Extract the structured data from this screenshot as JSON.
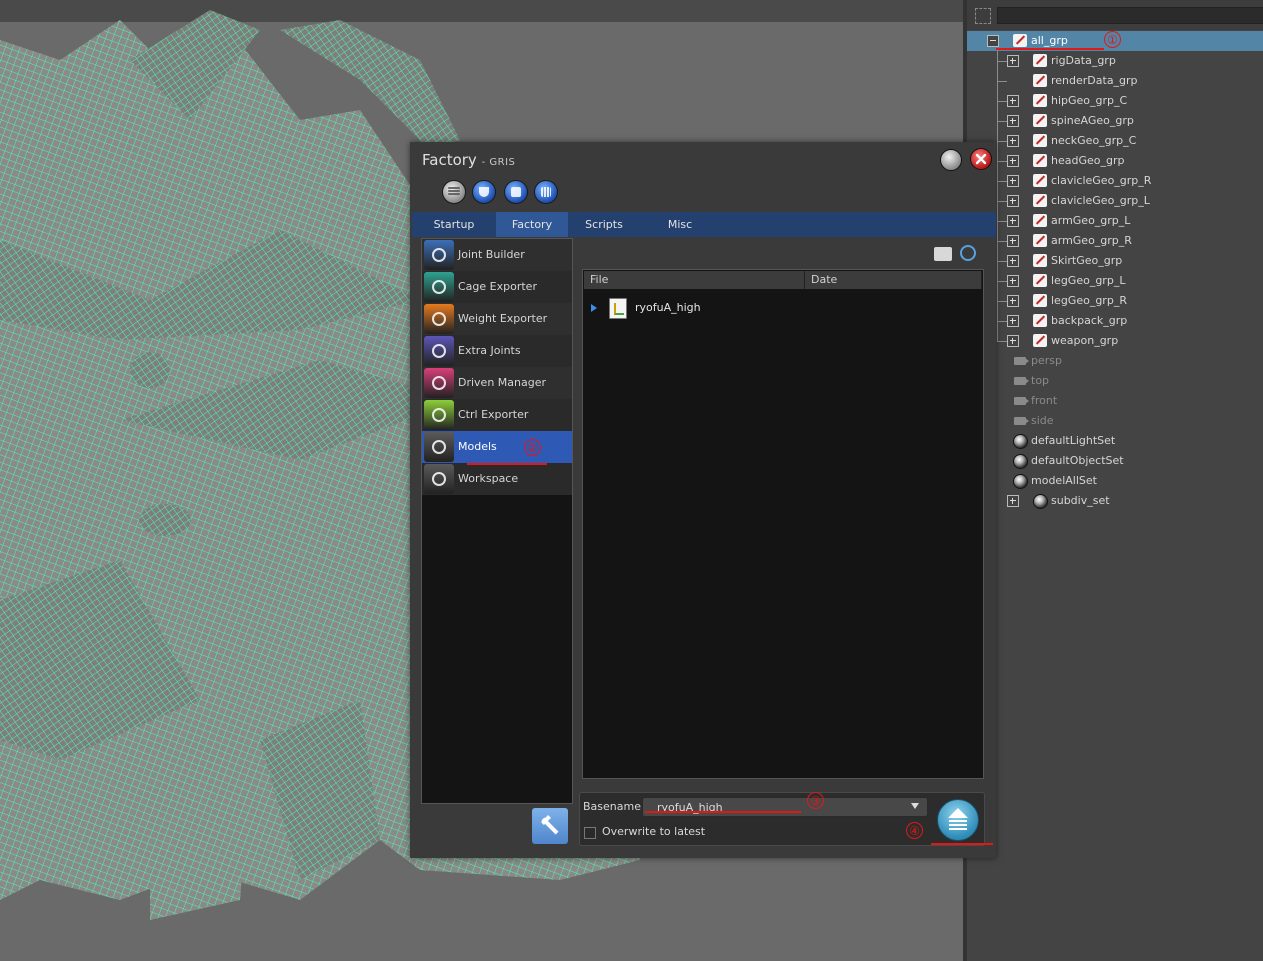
{
  "factory": {
    "title": "Factory",
    "subtitle": "GRIS",
    "tabs": [
      "Startup",
      "Factory",
      "Scripts",
      "Misc"
    ],
    "active_tab": "Factory",
    "tools": [
      {
        "label": "Joint Builder",
        "icon": "joint-builder-icon",
        "color": "#3c6fb8"
      },
      {
        "label": "Cage Exporter",
        "icon": "cage-exporter-icon",
        "color": "#2fa28f"
      },
      {
        "label": "Weight Exporter",
        "icon": "weight-exporter-icon",
        "color": "#e67a1e"
      },
      {
        "label": "Extra Joints",
        "icon": "extra-joints-icon",
        "color": "#5d56b8"
      },
      {
        "label": "Driven Manager",
        "icon": "driven-manager-icon",
        "color": "#d8407a"
      },
      {
        "label": "Ctrl Exporter",
        "icon": "ctrl-exporter-icon",
        "color": "#8ccf3a"
      },
      {
        "label": "Models",
        "icon": "models-icon",
        "color": "#5a5a5a"
      },
      {
        "label": "Workspace",
        "icon": "workspace-icon",
        "color": "#5a5a5a"
      }
    ],
    "selected_tool": "Models",
    "file_columns": [
      "File",
      "Date"
    ],
    "files": [
      {
        "name": "ryofuA_high",
        "date": ""
      }
    ],
    "basename_label": "Basename",
    "basename_value": "ryofuA_high",
    "overwrite_label": "Overwrite to latest",
    "overwrite_checked": false
  },
  "outliner": {
    "items": [
      {
        "label": "all_grp",
        "type": "group",
        "selected": true
      },
      {
        "label": "rigData_grp",
        "type": "group"
      },
      {
        "label": "renderData_grp",
        "type": "group"
      },
      {
        "label": "hipGeo_grp_C",
        "type": "group"
      },
      {
        "label": "spineAGeo_grp",
        "type": "group"
      },
      {
        "label": "neckGeo_grp_C",
        "type": "group"
      },
      {
        "label": "headGeo_grp",
        "type": "group"
      },
      {
        "label": "clavicleGeo_grp_R",
        "type": "group"
      },
      {
        "label": "clavicleGeo_grp_L",
        "type": "group"
      },
      {
        "label": "armGeo_grp_L",
        "type": "group"
      },
      {
        "label": "armGeo_grp_R",
        "type": "group"
      },
      {
        "label": "SkirtGeo_grp",
        "type": "group"
      },
      {
        "label": "legGeo_grp_L",
        "type": "group"
      },
      {
        "label": "legGeo_grp_R",
        "type": "group"
      },
      {
        "label": "backpack_grp",
        "type": "group"
      },
      {
        "label": "weapon_grp",
        "type": "group"
      },
      {
        "label": "persp",
        "type": "camera"
      },
      {
        "label": "top",
        "type": "camera"
      },
      {
        "label": "front",
        "type": "camera"
      },
      {
        "label": "side",
        "type": "camera"
      },
      {
        "label": "defaultLightSet",
        "type": "set"
      },
      {
        "label": "defaultObjectSet",
        "type": "set"
      },
      {
        "label": "modelAllSet",
        "type": "set"
      },
      {
        "label": "subdiv_set",
        "type": "set"
      }
    ]
  },
  "annotations": [
    "①",
    "②",
    "③",
    "④"
  ],
  "colors": {
    "wireframe": "#4ef5a8",
    "highlight": "#5285a6",
    "annotation": "#e01818",
    "tab_active": "#315896"
  }
}
